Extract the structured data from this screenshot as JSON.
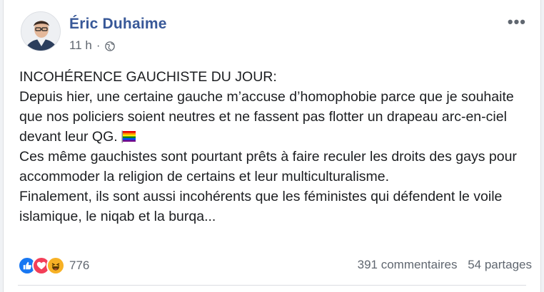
{
  "post": {
    "author": "Éric Duhaime",
    "time": "11 h",
    "separator": "·",
    "privacy_icon": "globe-icon",
    "more_icon": "more-options-icon",
    "more_label": "•••",
    "paragraphs": [
      "INCOHÉRENCE GAUCHISTE DU JOUR:",
      "Depuis hier, une certaine gauche m’accuse d’homophobie parce que je souhaite que nos policiers soient neutres et ne fassent pas flotter un drapeau arc-en-ciel devant leur QG.",
      "Ces même gauchistes sont pourtant prêts à faire reculer les droits des gays pour accommoder la religion de certains et leur multiculturalisme.",
      "Finalement, ils sont aussi incohérents que les féministes qui défendent le voile islamique, le niqab et la burqa..."
    ],
    "emoji": "rainbow-flag-icon"
  },
  "footer": {
    "reaction_icons": [
      "like-icon",
      "love-icon",
      "haha-icon"
    ],
    "reaction_count": "776",
    "comments": "391 commentaires",
    "shares": "54 partages"
  },
  "colors": {
    "author": "#385898",
    "like": "#1877f2",
    "love": "#f33e58",
    "haha": "#f7b125",
    "muted": "#606770"
  }
}
